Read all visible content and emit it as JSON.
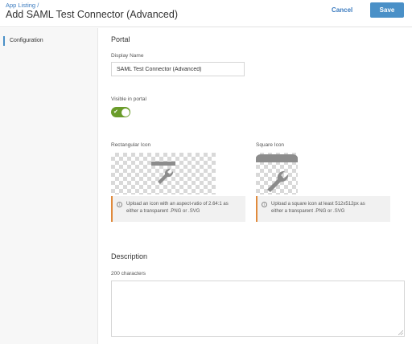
{
  "header": {
    "breadcrumb": "App Listing /",
    "title": "Add SAML Test Connector (Advanced)",
    "cancel_label": "Cancel",
    "save_label": "Save"
  },
  "sidebar": {
    "items": [
      {
        "label": "Configuration",
        "active": true
      }
    ]
  },
  "portal": {
    "section_title": "Portal",
    "display_name_label": "Display Name",
    "display_name_value": "SAML Test Connector (Advanced)",
    "visible_label": "Visible in portal",
    "visible_on": true,
    "rect_icon_label": "Rectangular Icon",
    "rect_icon_hint_line1": "Upload an icon with an aspect-ratio of 2.64:1 as",
    "rect_icon_hint_line2": "either a transparent .PNG or .SVG",
    "square_icon_label": "Square Icon",
    "square_icon_hint_line1": "Upload a square icon at least 512x512px as",
    "square_icon_hint_line2": "either a transparent .PNG or .SVG"
  },
  "description": {
    "section_title": "Description",
    "char_count_label": "200 characters",
    "value": ""
  },
  "colors": {
    "accent": "#4a90c7",
    "toggle_on": "#6a9c2a",
    "warning_border": "#e08a3c"
  },
  "icons": [
    "info-icon",
    "wrench-icon",
    "check-icon",
    "resize-grip-icon"
  ]
}
